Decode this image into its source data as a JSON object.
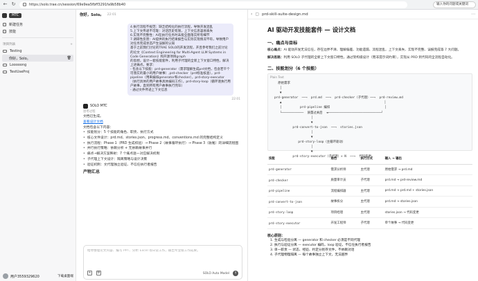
{
  "browser": {
    "url": "https://solo.trae.cn/session/69e9ea5fbff3291fa9b58b40",
    "search_label": "输入你的问题或关键词"
  },
  "sidebar": {
    "brand": "MTC",
    "items": [
      {
        "label": "新建任务",
        "icon": "new-task-icon"
      },
      {
        "label": "技能",
        "icon": "skills-icon"
      }
    ],
    "section_label": "项目列表",
    "projects": [
      {
        "label": "Testing",
        "subitems": [
          {
            "label": "你好，Solo。"
          }
        ]
      },
      {
        "label": "Looooong",
        "subitems": []
      },
      {
        "label": "TestUseProj",
        "subitems": []
      }
    ],
    "user": "用户3559329620",
    "download": "下载桌面端"
  },
  "chat": {
    "header_title": "你好，Solo。",
    "header_time": "22:01",
    "bubble_lines": [
      "4.执行流程不规范：缺乏结构化的执行流程，导致开发混乱",
      "5.上下文传递不可靠：对话历史有限，上下文信息容易丢失",
      "6.实现不完整性：AI在执行任务时未能全面落实所有细节",
      "7.调研性反馈：AI提供的执行结果报告与实际实现情况不符，导致用户对任务完成状态产生误解的认知",
      "基于之前我们讨论的TRAE SOLO的开发流程，开且参考我们之前讨论的论文《Context Engineering for Multi-Agent LLM Systems in Code Generation》和开源项目graph",
      "的思想，设计一套技能套件，利用子代理的全新上下文窗口特性，解决上述痛点。要求：",
      "- 包含以下技能：prd-generator（需求理解生成prd文档，包含若干个可落实的最小的用户故事）,prd-checker（prd标准核查），prd-pipeline（用来编排generator和checker），prd-story-executor（执行具体的用户故事具体编码工作），prd-story-loop（循环逐执行用户故事，直到所有用户故事执行完毕）",
      "- 通过文件传递上下文信息"
    ],
    "bubble_time": "22:01",
    "agent_name": "SOLO MTC",
    "thinking": "思考过程",
    "created_label": "文档已生成。",
    "view_doc": "查看设计文档",
    "summary_intro": "文档包含以下内容：",
    "bullets": [
      "技能划分：5 个技能的角色、职责、执行方式",
      "核心文件设计：prd.md、stories.json、progress.md、conventions.md 的完整结构定义",
      "执行流程：Phase 1（PRD 生成校验）→ Phase 2（故事循环执行）→ Phase 3（收尾）的详细流程图",
      "并行执行策略：依赖分析 + 无依赖故事并行",
      "痛点→解决方案映射：7 个痛点逐一对应解决机制",
      "子代理上下文设计：隔离策略与设计决策",
      "验证机制：文代理独立验证、不信任执行者报告"
    ],
    "section_heading": "产物汇总",
    "input_placeholder": "给你整理论文内容、编写 PPT、分析 Excel 等日常工作，输出专业级工作成果。",
    "model_label": "SOLO Auto Model"
  },
  "doc": {
    "tab_title": "prd-skill-suite-design.md",
    "title": "AI 驱动开发技能套件 — 设计文档",
    "sec1": "一、痛点与目标",
    "core_label": "核心痛点：",
    "core_text": "AI 驱动开发无法信任，存在边界不清、理解偏差、功能遗漏、流程混乱、上下文丢失、实现不完整、误报完成等 7 大问题。",
    "solution_label": "解决思路：",
    "solution_text": "利用 SOLO 子代理的全新上下文窗口特性，通过架构级设计（而非提示词约束），实现从 PRD 到代码的全流程自动化。",
    "sec2": "二、技能划分（6 个技能）",
    "flow_label": "Plain Text",
    "flow_text": "  原始需求\n   │\n   ▼\nprd-generator  ──→  prd.md  ──→  prd-checker（子代理）──→  prd-review.md\n   ▲                                                        │\n   │          prd-pipeline 编排                              │\n   └────────────  质量过关后  ◄─────────────────────────────┘\n                    │\n                    ▼\n          prd-convert-to-json  ──→  stories.json\n                    │\n                    ▼\n             prd-story-loop（主循环驱动）\n                    │\n                    ▼\n          prd-story-executor（子代理）× N  ──→  代码变更",
    "table_headers": [
      "技能",
      "角色",
      "执行方式",
      "输入 → 输出"
    ],
    "table_rows": [
      [
        "prd-generator",
        "需求分析师",
        "主代理",
        "原始需求 → prd.md"
      ],
      [
        "prd-checker",
        "质量审计员",
        "子代理",
        "prd.md → prd-review.md"
      ],
      [
        "prd-pipeline",
        "流程编排器",
        "主代理",
        "prd.md → prd.md + stories.json"
      ],
      [
        "prd-convert-to-json",
        "故事拆分",
        "主代理",
        "prd.md → stories.json"
      ],
      [
        "prd-story-loop",
        "项目经理",
        "主代理",
        "stories.json → 代码变更"
      ],
      [
        "prd-story-executor",
        "开发工程师",
        "子代理",
        "单个故事 → 代码变更"
      ]
    ],
    "core_design_label": "核心原则：",
    "principles": [
      "生成与检验分离 — generator 和 checker 必须是不同代理",
      "执行与验证分离 — executor 编码，loop 验证，不信任执行者报告",
      "单一职责 — 状态、经验、约定分别存文件，不依赖对话",
      "子代理物理隔离 — 每个故事独立上下文，无法越界"
    ]
  }
}
